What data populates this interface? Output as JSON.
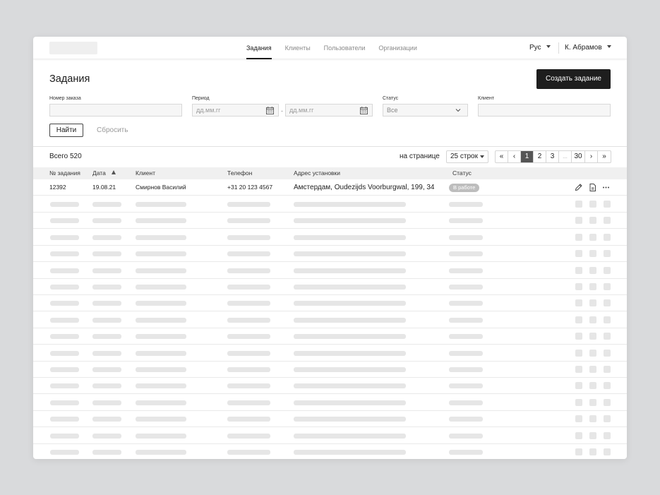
{
  "nav": {
    "items": [
      "Задания",
      "Клиенты",
      "Пользователи",
      "Организации"
    ],
    "active_index": 0,
    "language": "Рус",
    "user": "К. Абрамов"
  },
  "page": {
    "title": "Задания",
    "create_button": "Создать задание"
  },
  "filters": {
    "order_label": "Номер заказа",
    "period_label": "Период",
    "date_placeholder": "дд.мм.гг",
    "dash": "-",
    "status_label": "Статус",
    "status_value": "Все",
    "client_label": "Клиент",
    "find_button": "Найти",
    "reset_button": "Сбросить"
  },
  "list": {
    "total_label": "Всего 520",
    "per_page_label": "на странице",
    "per_page_value": "25 строк",
    "pages": [
      "1",
      "2",
      "3",
      "...",
      "30"
    ],
    "current_page": "1",
    "first_icon": "«",
    "prev_icon": "‹",
    "next_icon": "›",
    "last_icon": "»"
  },
  "table": {
    "columns": [
      "№ задания",
      "Дата",
      "Клиент",
      "Телефон",
      "Адрес установки",
      "Статус"
    ],
    "sorted_column": "Дата",
    "rows": [
      {
        "id": "12392",
        "date": "19.08.21",
        "client": "Смирнов Василий",
        "phone": "+31 20 123 4567",
        "address": "Амстердам, Oudezijds Voorburgwal, 199, 34",
        "status": "В работе",
        "actions": [
          "pencil-icon",
          "document-icon",
          "more-icon"
        ]
      }
    ],
    "placeholder_row_count": 16
  },
  "colors": {
    "primary_button": "#1e1e1e",
    "status_badge": "#bdbdbd",
    "active_page": "#555555",
    "skeleton": "#e6e6e6"
  }
}
